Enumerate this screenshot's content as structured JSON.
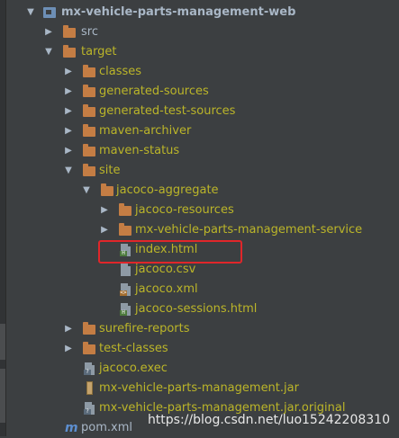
{
  "tree": {
    "root": {
      "label": "mx-vehicle-parts-management-web",
      "expanded": true,
      "icon": "module-icon"
    },
    "items": [
      {
        "label": "src",
        "icon": "folder-icon",
        "arrow": "collapsed"
      },
      {
        "label": "target",
        "icon": "folder-icon",
        "arrow": "expanded"
      },
      {
        "label": "classes",
        "icon": "folder-icon",
        "arrow": "collapsed"
      },
      {
        "label": "generated-sources",
        "icon": "folder-icon",
        "arrow": "collapsed"
      },
      {
        "label": "generated-test-sources",
        "icon": "folder-icon",
        "arrow": "collapsed"
      },
      {
        "label": "maven-archiver",
        "icon": "folder-icon",
        "arrow": "collapsed"
      },
      {
        "label": "maven-status",
        "icon": "folder-icon",
        "arrow": "collapsed"
      },
      {
        "label": "site",
        "icon": "folder-icon",
        "arrow": "expanded"
      },
      {
        "label": "jacoco-aggregate",
        "icon": "folder-icon",
        "arrow": "expanded"
      },
      {
        "label": "jacoco-resources",
        "icon": "folder-icon",
        "arrow": "collapsed"
      },
      {
        "label": "mx-vehicle-parts-management-service",
        "icon": "folder-icon",
        "arrow": "collapsed"
      },
      {
        "label": "index.html",
        "icon": "html-file-icon",
        "selected": true
      },
      {
        "label": "jacoco.csv",
        "icon": "csv-file-icon"
      },
      {
        "label": "jacoco.xml",
        "icon": "xml-file-icon"
      },
      {
        "label": "jacoco-sessions.html",
        "icon": "html-file-icon"
      },
      {
        "label": "surefire-reports",
        "icon": "folder-icon",
        "arrow": "collapsed"
      },
      {
        "label": "test-classes",
        "icon": "folder-icon",
        "arrow": "collapsed"
      },
      {
        "label": "jacoco.exec",
        "icon": "unknown-file-icon"
      },
      {
        "label": "mx-vehicle-parts-management.jar",
        "icon": "jar-file-icon"
      },
      {
        "label": "mx-vehicle-parts-management.jar.original",
        "icon": "unknown-file-icon"
      },
      {
        "label": "pom.xml",
        "icon": "maven-icon"
      }
    ]
  },
  "watermark": "https://blog.csdn.net/luo15242208310",
  "colors": {
    "background": "#3c3f41",
    "text": "#a9b7c6",
    "excluded_text": "#bbb529",
    "folder": "#c47d44",
    "highlight": "#e0262a"
  }
}
